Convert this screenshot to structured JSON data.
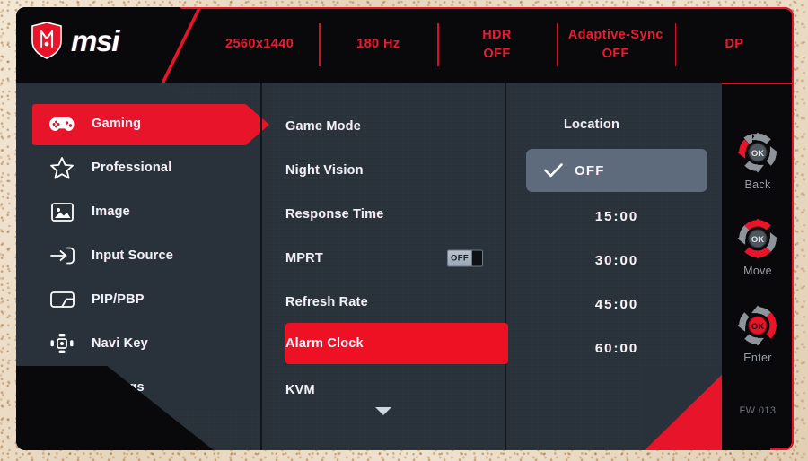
{
  "brand": {
    "name": "msi",
    "logo_icon": "msi-dragon-shield-icon"
  },
  "header": {
    "status": [
      {
        "label": "2560x1440",
        "sub": ""
      },
      {
        "label": "180 Hz",
        "sub": ""
      },
      {
        "label": "HDR",
        "sub": "OFF"
      },
      {
        "label": "Adaptive-Sync",
        "sub": "OFF"
      },
      {
        "label": "DP",
        "sub": ""
      }
    ]
  },
  "sidebar": {
    "items": [
      {
        "label": "Gaming",
        "icon": "gamepad-icon",
        "active": true
      },
      {
        "label": "Professional",
        "icon": "star-icon",
        "active": false
      },
      {
        "label": "Image",
        "icon": "picture-icon",
        "active": false
      },
      {
        "label": "Input Source",
        "icon": "input-arrow-icon",
        "active": false
      },
      {
        "label": "PIP/PBP",
        "icon": "pip-pbp-icon",
        "active": false
      },
      {
        "label": "Navi Key",
        "icon": "navi-key-icon",
        "active": false
      },
      {
        "label": "Settings",
        "icon": "gear-icon",
        "active": false
      }
    ]
  },
  "menu": {
    "items": [
      {
        "label": "Game Mode",
        "active": false
      },
      {
        "label": "Night Vision",
        "active": false
      },
      {
        "label": "Response Time",
        "active": false
      },
      {
        "label": "MPRT",
        "active": false,
        "toggle": "OFF"
      },
      {
        "label": "Refresh Rate",
        "active": false
      },
      {
        "label": "Alarm Clock",
        "active": true
      },
      {
        "label": "KVM",
        "active": false
      }
    ],
    "scroll_down_icon": "chevron-down-icon"
  },
  "values": {
    "title": "Location",
    "options": [
      {
        "label": "OFF",
        "selected": true
      },
      {
        "label": "15:00",
        "selected": false
      },
      {
        "label": "30:00",
        "selected": false
      },
      {
        "label": "45:00",
        "selected": false
      },
      {
        "label": "60:00",
        "selected": false
      }
    ],
    "check_icon": "checkmark-icon"
  },
  "nav": {
    "groups": [
      {
        "label": "Back",
        "icon": "dpad-left-icon"
      },
      {
        "label": "Move",
        "icon": "dpad-up-down-icon"
      },
      {
        "label": "Enter",
        "icon": "dpad-ok-right-icon"
      }
    ],
    "firmware": "FW 013"
  },
  "colors": {
    "accent_red": "#e8142a",
    "panel_dark": "#29313a",
    "frame_black": "#09080b",
    "select_slate": "#5d6b7c",
    "text_light": "#eef2f6"
  }
}
